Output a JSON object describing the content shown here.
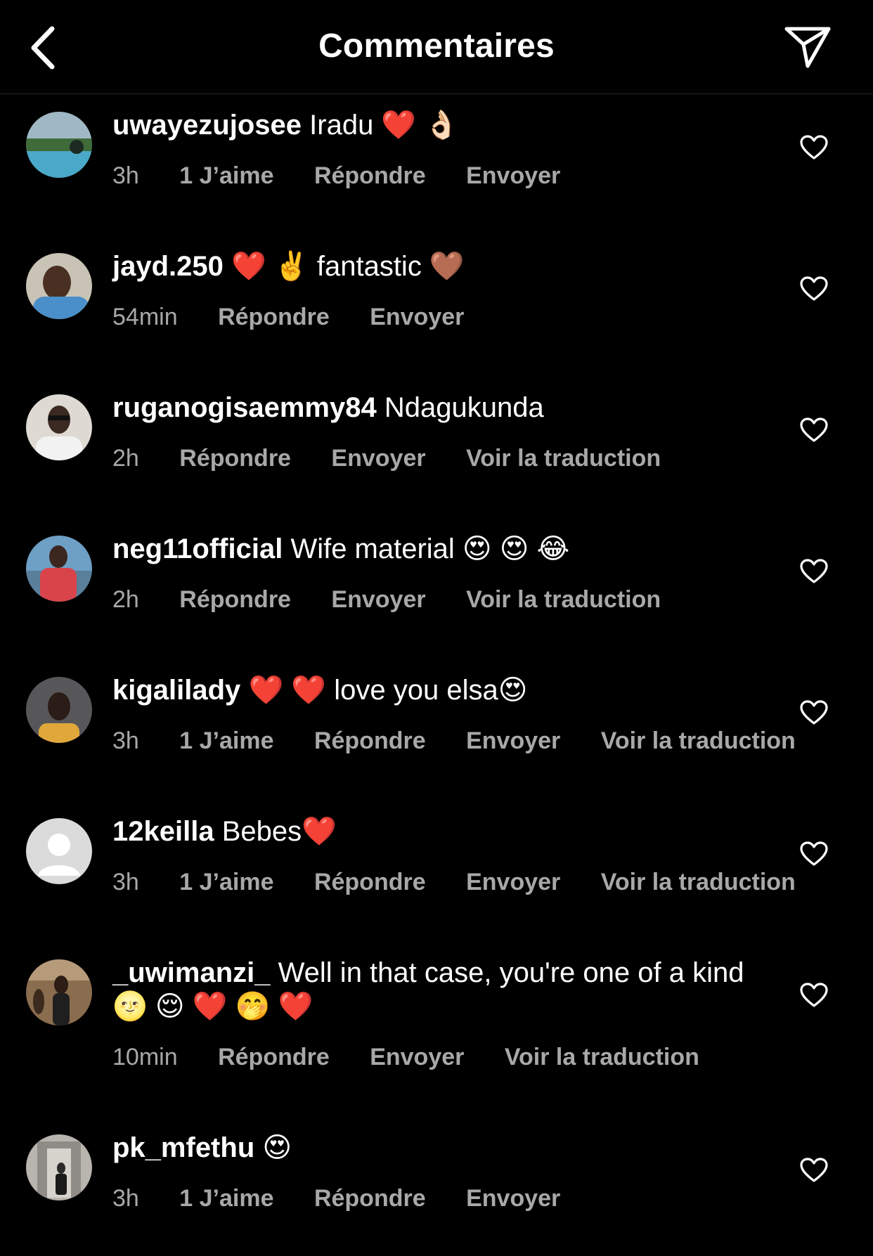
{
  "header": {
    "title": "Commentaires"
  },
  "comments": [
    {
      "username": "uwayezujosee",
      "text": "Iradu ❤️ 👌🏻",
      "time": "3h",
      "likes": "1 J’aime",
      "reply": "Répondre",
      "send": "Envoyer"
    },
    {
      "username": "jayd.250",
      "text": "❤️ ✌️ fantastic 🤎",
      "time": "54min",
      "reply": "Répondre",
      "send": "Envoyer"
    },
    {
      "username": "ruganogisaemmy84",
      "text": "Ndagukunda",
      "time": "2h",
      "reply": "Répondre",
      "send": "Envoyer",
      "translate": "Voir la traduction"
    },
    {
      "username": "neg11official",
      "text": "Wife material 😍 😍 😂",
      "time": "2h",
      "reply": "Répondre",
      "send": "Envoyer",
      "translate": "Voir la traduction"
    },
    {
      "username": "kigalilady",
      "text": "❤️ ❤️ love you elsa😍",
      "time": "3h",
      "likes": "1 J’aime",
      "reply": "Répondre",
      "send": "Envoyer",
      "translate": "Voir la traduction"
    },
    {
      "username": "12keilla",
      "text": "Bebes❤️",
      "time": "3h",
      "likes": "1 J’aime",
      "reply": "Répondre",
      "send": "Envoyer",
      "translate": "Voir la traduction"
    },
    {
      "username": "_uwimanzi_",
      "text": "Well in that case, you're one of a kind 🌝 😌 ❤️ 🤭 ❤️",
      "time": "10min",
      "reply": "Répondre",
      "send": "Envoyer",
      "translate": "Voir la traduction"
    },
    {
      "username": "pk_mfethu",
      "text": "😍",
      "time": "3h",
      "likes": "1 J’aime",
      "reply": "Répondre",
      "send": "Envoyer"
    }
  ],
  "icons": {
    "back": "chevron-left-icon",
    "send": "paper-plane-icon",
    "like": "heart-outline-icon"
  },
  "colors": {
    "background": "#000000",
    "text": "#ffffff",
    "secondary": "#a8a8a8"
  }
}
